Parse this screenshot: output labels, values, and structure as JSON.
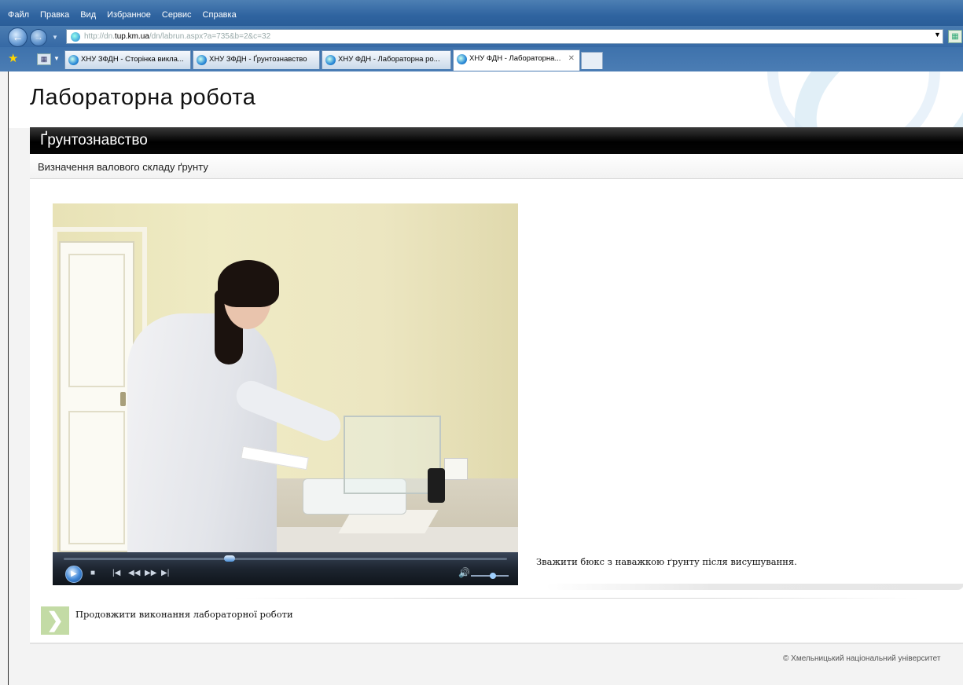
{
  "browser": {
    "menu": [
      "Файл",
      "Правка",
      "Вид",
      "Избранное",
      "Сервис",
      "Справка"
    ],
    "address": {
      "prefix": "http://dn.",
      "host": "tup.km.ua",
      "path": "/dn/labrun.aspx?a=735&b=2&c=32"
    },
    "tabs": [
      {
        "label": "ХНУ ЗФДН - Сторінка викла..."
      },
      {
        "label": "ХНУ ЗФДН - Ґрунтознавство"
      },
      {
        "label": "ХНУ ФДН - Лабораторна ро..."
      },
      {
        "label": "ХНУ ФДН - Лабораторна..."
      }
    ]
  },
  "page": {
    "title": "Лабораторна робота",
    "subject": "Ґрунтознавство",
    "topic": "Визначення валового складу ґрунту",
    "step_caption": "Зважити бюкс з наважкою ґрунту після висушування.",
    "continue_label": "Продовжити виконання лабораторної роботи",
    "footer": "© Хмельницький національний університет"
  },
  "player": {
    "progress": 0.37,
    "volume": 0.6
  }
}
